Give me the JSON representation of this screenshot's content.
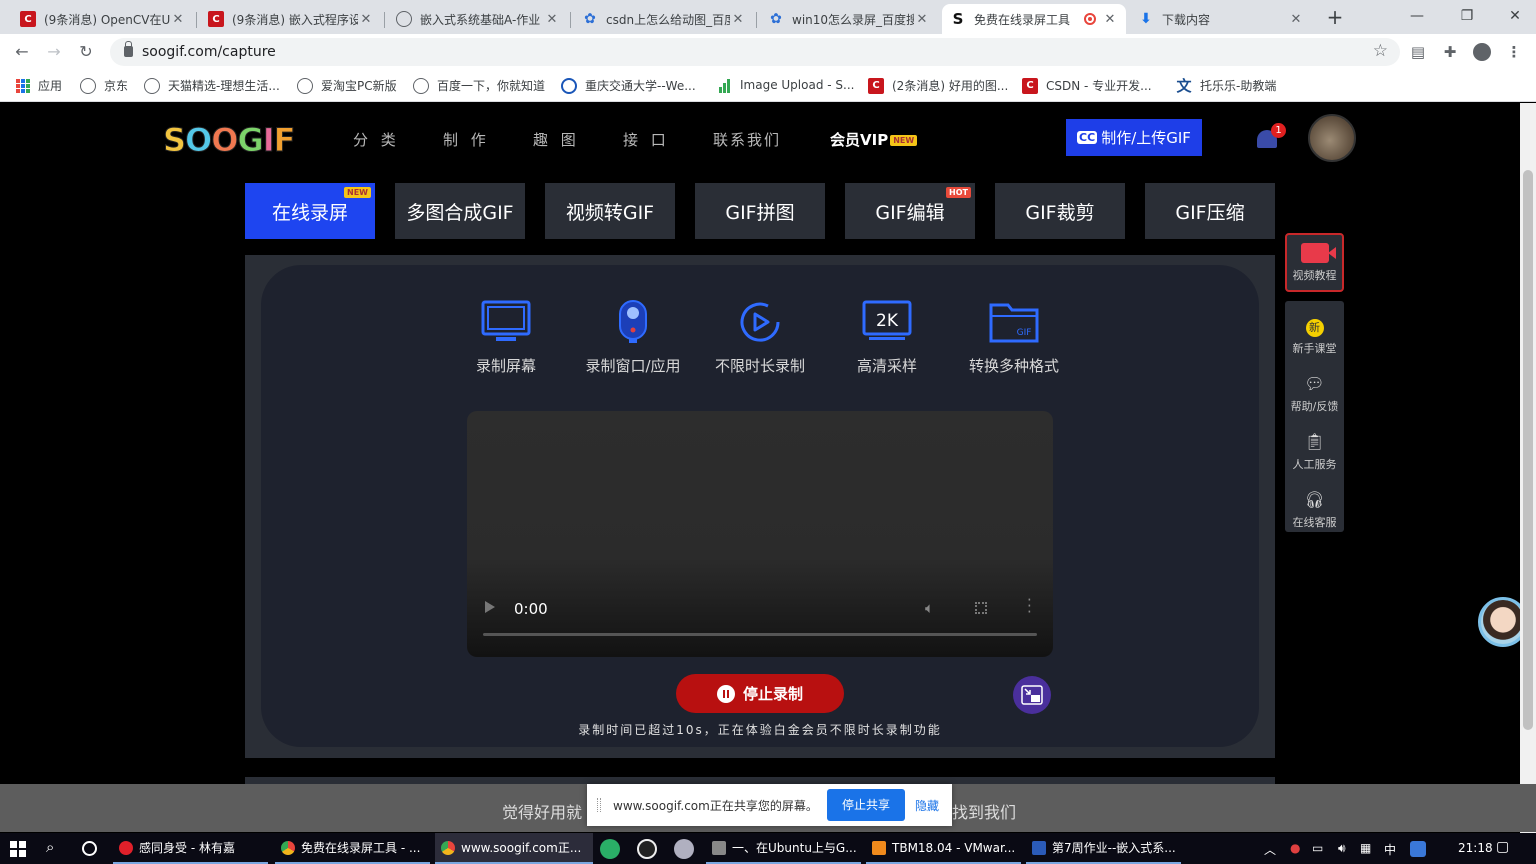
{
  "browser": {
    "tabs": [
      {
        "title": "(9条消息) OpenCV在U",
        "icon": "csdn-icon"
      },
      {
        "title": "(9条消息) 嵌入式程序设",
        "icon": "csdn-icon"
      },
      {
        "title": "嵌入式系统基础A-作业",
        "icon": "globe-icon"
      },
      {
        "title": "csdn上怎么给动图_百度",
        "icon": "baidu-paw-icon"
      },
      {
        "title": "win10怎么录屏_百度搜",
        "icon": "baidu-paw-icon"
      },
      {
        "title": "免费在线录屏工具",
        "icon": "soogif-icon",
        "active": true
      },
      {
        "title": "下载内容",
        "icon": "download-icon"
      }
    ],
    "url": "soogif.com/capture",
    "bookmarks": [
      {
        "label": "应用",
        "icon": "apps-icon"
      },
      {
        "label": "京东",
        "icon": "globe-icon"
      },
      {
        "label": "天猫精选-理想生活...",
        "icon": "globe-icon"
      },
      {
        "label": "爱淘宝PC新版",
        "icon": "globe-icon"
      },
      {
        "label": "百度一下，你就知道",
        "icon": "globe-icon"
      },
      {
        "label": "重庆交通大学--We...",
        "icon": "cqjtu-icon"
      },
      {
        "label": "Image Upload - S...",
        "icon": "bars-icon"
      },
      {
        "label": "(2条消息) 好用的图...",
        "icon": "csdn-icon"
      },
      {
        "label": "CSDN - 专业开发...",
        "icon": "csdn-icon"
      },
      {
        "label": "托乐乐-助教端",
        "icon": "wen-icon"
      }
    ]
  },
  "site": {
    "logo": "SOOGIF",
    "nav": [
      "分 类",
      "制 作",
      "趣 图",
      "接 口",
      "联系我们"
    ],
    "vip_label": "会员VIP",
    "vip_badge": "NEW",
    "upload_label": "制作/上传GIF",
    "upload_icon": "CC",
    "notifications_count": "1"
  },
  "tool_tabs": [
    {
      "label": "在线录屏",
      "badge": "NEW",
      "active": true
    },
    {
      "label": "多图合成GIF"
    },
    {
      "label": "视频转GIF"
    },
    {
      "label": "GIF拼图"
    },
    {
      "label": "GIF编辑",
      "badge": "HOT"
    },
    {
      "label": "GIF裁剪"
    },
    {
      "label": "GIF压缩"
    }
  ],
  "features": [
    {
      "label": "录制屏幕",
      "icon": "monitor-icon"
    },
    {
      "label": "录制窗口/应用",
      "icon": "webcam-icon"
    },
    {
      "label": "不限时长录制",
      "icon": "play-circle-icon"
    },
    {
      "label": "高清采样",
      "icon": "2k-monitor-icon",
      "icon_text": "2K"
    },
    {
      "label": "转换多种格式",
      "icon": "gif-folder-icon",
      "icon_text": "GIF"
    }
  ],
  "video": {
    "time": "0:00"
  },
  "recording": {
    "stop_label": "停止录制",
    "note": "录制时间已超过10s，正在体验白金会员不限时长录制功能"
  },
  "side": {
    "video_tutorial": "视频教程",
    "items": [
      "新手课堂",
      "帮助/反馈",
      "人工服务",
      "在线客服"
    ]
  },
  "share": {
    "bg_left": "觉得好用就",
    "bg_right": "找到我们",
    "message": "www.soogif.com正在共享您的屏幕。",
    "stop_label": "停止共享",
    "hide_label": "隐藏"
  },
  "taskbar": {
    "apps": [
      {
        "label": "感同身受 - 林有嘉",
        "color": "#e0202a"
      },
      {
        "label": "免费在线录屏工具 - ...",
        "color": "#f2b51c"
      },
      {
        "label": "www.soogif.com正...",
        "color": "#f2b51c",
        "active": true
      },
      {
        "label": "一、在Ubuntu上与G...",
        "color": "#888888"
      },
      {
        "label": "TBM18.04 - VMwar...",
        "color": "#f08a1c"
      },
      {
        "label": "第7周作业--嵌入式系...",
        "color": "#2b5bb8"
      }
    ],
    "ime": "中",
    "clock": "21:18"
  }
}
